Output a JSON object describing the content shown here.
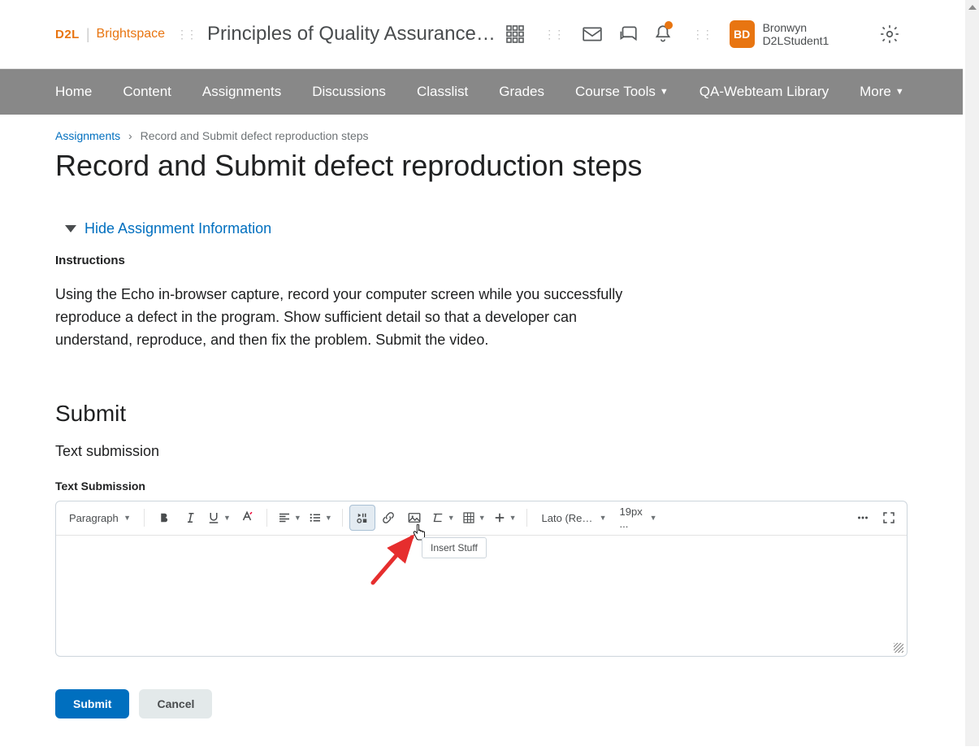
{
  "header": {
    "logo_d2l": "D2L",
    "logo_brightspace": "Brightspace",
    "course_title": "Principles of Quality Assurance - F...",
    "avatar_initials": "BD",
    "username": "Bronwyn D2LStudent1"
  },
  "nav": {
    "items": [
      "Home",
      "Content",
      "Assignments",
      "Discussions",
      "Classlist",
      "Grades",
      "Course Tools",
      "QA-Webteam Library",
      "More"
    ],
    "dropdown_indices": [
      6,
      8
    ]
  },
  "breadcrumb": {
    "root": "Assignments",
    "current": "Record and Submit defect reproduction steps"
  },
  "page_title": "Record and Submit defect reproduction steps",
  "toggle": {
    "label": "Hide Assignment Information"
  },
  "instructions": {
    "heading": "Instructions",
    "body": "Using the Echo in-browser capture, record your computer screen while you successfully reproduce a defect in the program. Show sufficient detail so that a developer can understand, reproduce, and then fix the problem. Submit the video."
  },
  "submit": {
    "heading": "Submit",
    "subtext": "Text submission",
    "field_label": "Text Submission"
  },
  "editor": {
    "paragraph": "Paragraph",
    "font": "Lato (Recom...",
    "size": "19px ...",
    "tooltip": "Insert Stuff"
  },
  "actions": {
    "submit": "Submit",
    "cancel": "Cancel"
  }
}
